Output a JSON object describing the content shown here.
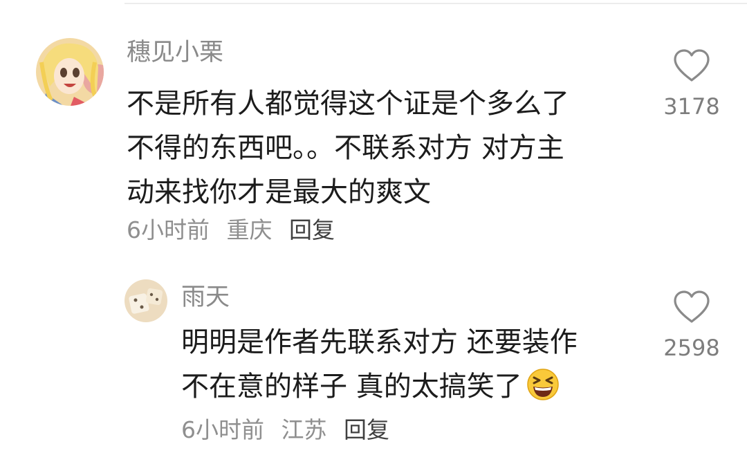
{
  "comments": [
    {
      "username": "穗见小栗",
      "text_lines": [
        "不是所有人都觉得这个证是个多么了",
        "不得的东西吧。。不联系对方 对方主",
        "动来找你才是最大的爽文"
      ],
      "time": "6小时前",
      "location": "重庆",
      "reply_label": "回复",
      "likes": "3178",
      "avatar_icon": "anime-girl-avatar"
    },
    {
      "username": "雨天",
      "text_lines": [
        "明明是作者先联系对方 还要装作",
        "不在意的样子 真的太搞笑了"
      ],
      "emoji": "grinning-squinting-face-emoji",
      "time": "6小时前",
      "location": "江苏",
      "reply_label": "回复",
      "likes": "2598",
      "avatar_icon": "dice-avatar"
    }
  ],
  "colors": {
    "username": "#8a8a8a",
    "text": "#1c1c1c",
    "meta": "#8f8f8f",
    "reply": "#404040",
    "like": "#7d7d7d"
  }
}
